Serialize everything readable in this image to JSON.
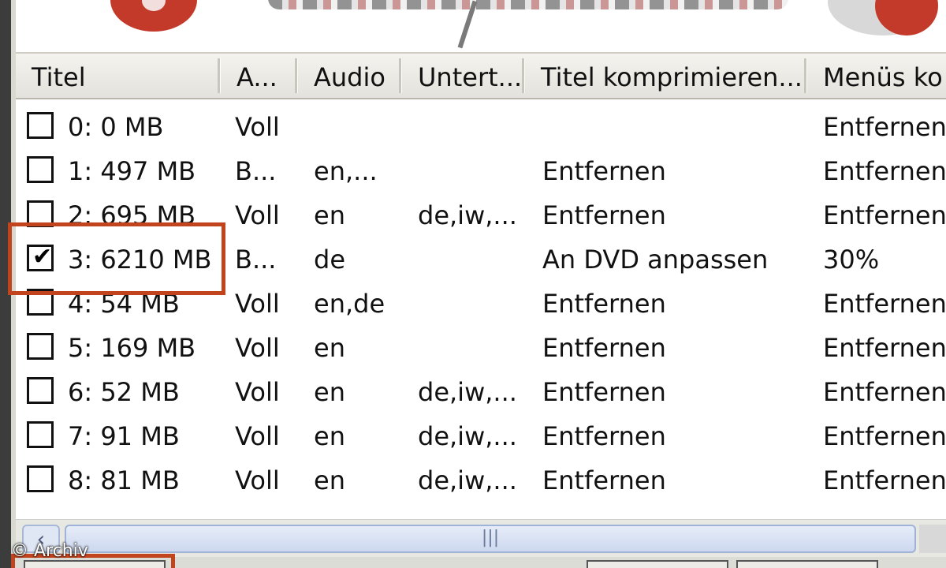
{
  "columns": [
    "Titel",
    "A...",
    "Audio",
    "Untert...",
    "Titel komprimieren...",
    "Menüs ko"
  ],
  "rows": [
    {
      "titel": "0: 0 MB",
      "a": "Voll",
      "audio": "",
      "untert": "",
      "komprimieren": "",
      "menus": "Entfernen",
      "checked": false
    },
    {
      "titel": "1: 497 MB",
      "a": "B...",
      "audio": "en,...",
      "untert": "",
      "komprimieren": "Entfernen",
      "menus": "Entfernen",
      "checked": false
    },
    {
      "titel": "2: 695 MB",
      "a": "Voll",
      "audio": "en",
      "untert": "de,iw,...",
      "komprimieren": "Entfernen",
      "menus": "Entfernen",
      "checked": false
    },
    {
      "titel": "3: 6210 MB",
      "a": "B...",
      "audio": "de",
      "untert": "",
      "komprimieren": "An DVD anpassen",
      "menus": "30%",
      "checked": true
    },
    {
      "titel": "4: 54 MB",
      "a": "Voll",
      "audio": "en,de",
      "untert": "",
      "komprimieren": "Entfernen",
      "menus": "Entfernen",
      "checked": false
    },
    {
      "titel": "5: 169 MB",
      "a": "Voll",
      "audio": "en",
      "untert": "",
      "komprimieren": "Entfernen",
      "menus": "Entfernen",
      "checked": false
    },
    {
      "titel": "6: 52 MB",
      "a": "Voll",
      "audio": "en",
      "untert": "de,iw,...",
      "komprimieren": "Entfernen",
      "menus": "Entfernen",
      "checked": false
    },
    {
      "titel": "7: 91 MB",
      "a": "Voll",
      "audio": "en",
      "untert": "de,iw,...",
      "komprimieren": "Entfernen",
      "menus": "Entfernen",
      "checked": false
    },
    {
      "titel": "8: 81 MB",
      "a": "Voll",
      "audio": "en",
      "untert": "de,iw,...",
      "komprimieren": "Entfernen",
      "menus": "Entfernen",
      "checked": false
    }
  ],
  "scrollbar": {
    "left_arrow": "‹",
    "thumb_grip": "|||"
  },
  "watermark": "© Archiv",
  "colors": {
    "highlight": "#c2441e"
  }
}
